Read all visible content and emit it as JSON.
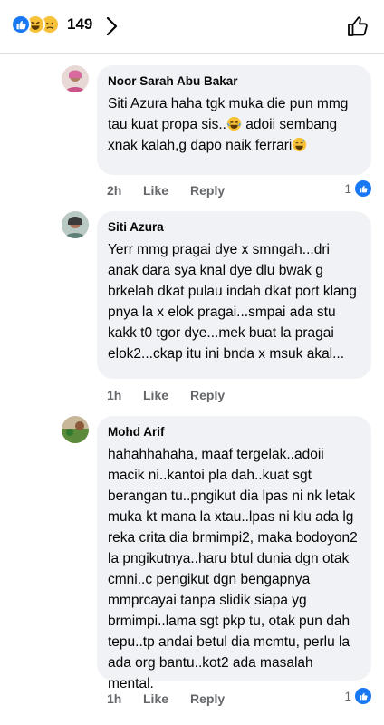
{
  "header": {
    "reaction_icons": [
      "like-reaction-icon",
      "haha-reaction-icon",
      "sad-reaction-icon"
    ],
    "reaction_count": "149",
    "colors": {
      "like": "#1877f2",
      "haha": "#f7c23a"
    }
  },
  "comments": [
    {
      "author": "Noor Sarah Abu Bakar",
      "text_parts": [
        "Siti Azura haha tgk muka die pun mmg tau kuat propa sis..",
        " adoii sembang xnak kalah,g dapo naik ferrari"
      ],
      "time": "2h",
      "like_label": "Like",
      "reply_label": "Reply",
      "like_count": "1"
    },
    {
      "author": "Siti Azura",
      "text": "Yerr mmg pragai dye x smngah...dri anak dara sya knal dye dlu bwak g brkelah dkat pulau indah dkat port klang pnya la x elok pragai...smpai ada stu kakk t0 tgor dye...mek buat la pragai elok2...ckap itu ini bnda x msuk akal...",
      "time": "1h",
      "like_label": "Like",
      "reply_label": "Reply"
    },
    {
      "author": "Mohd Arif",
      "text": "hahahhahaha, maaf tergelak..adoii macik ni..kantoi pla dah..kuat sgt berangan tu..pngikut dia lpas ni nk letak muka kt mana la xtau..lpas ni klu ada lg reka crita dia brmimpi2, maka bodoyon2 la pngikutnya..haru btul dunia dgn otak cmni..c pengikut dgn bengapnya mmprcayai tanpa slidik siapa yg brmimpi..lama sgt pkp tu, otak pun dah tepu..tp andai betul dia mcmtu, perlu la ada org bantu..kot2 ada masalah mental.",
      "time": "1h",
      "like_label": "Like",
      "reply_label": "Reply",
      "like_count": "1"
    }
  ]
}
